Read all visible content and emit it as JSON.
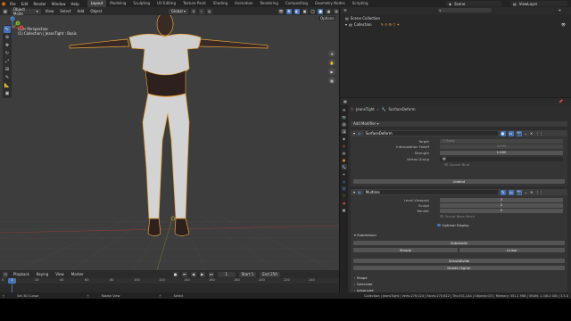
{
  "menu": [
    "File",
    "Edit",
    "Render",
    "Window",
    "Help"
  ],
  "workspaces": [
    "Layout",
    "Modeling",
    "Sculpting",
    "UV Editing",
    "Texture Paint",
    "Shading",
    "Animation",
    "Rendering",
    "Compositing",
    "Geometry Nodes",
    "Scripting"
  ],
  "active_workspace": "Layout",
  "scene": "Scene",
  "view_layer": "ViewLayer",
  "viewport_header": {
    "mode": "Object Mode",
    "menus": [
      "View",
      "Select",
      "Add",
      "Object"
    ],
    "orientation": "Global",
    "options": "Options"
  },
  "viewport": {
    "view_name": "User Perspective",
    "collection_info": "(1) Collection | JeansTight : Basis",
    "gizmo": {
      "x": "X",
      "y": "Y",
      "z": "Z"
    }
  },
  "timeline": {
    "menus": [
      "Playback",
      "Keying",
      "View",
      "Marker"
    ],
    "current_frame": "1",
    "start_label": "Start",
    "start": "1",
    "end_label": "End",
    "end": "250",
    "ticks": [
      "0",
      "20",
      "40",
      "60",
      "80",
      "100",
      "120",
      "140",
      "160",
      "180",
      "200",
      "220",
      "240"
    ]
  },
  "statusbar": {
    "left": "Set 3D Cursor",
    "middle": "Rotate View",
    "right": "Select",
    "stats": "Collection | JeansTight | Verts:276,024 | Faces:275,622 | Tris:551,244 | Objects:0/3 | Memory: 351.1 MiB | VRAM: 1.3/8.0 GiB | 3.5.0"
  },
  "outliner": {
    "rows": [
      "Scene Collection",
      "Collection"
    ]
  },
  "properties": {
    "breadcrumb_object": "JeansTight",
    "breadcrumb_modifier": "SurfaceDeform",
    "add_modifier": "Add Modifier",
    "surface_deform": {
      "name": "SurfaceDeform",
      "target_label": "Target",
      "target_value": "Body",
      "interp_label": "Interpolation Falloff",
      "interp_value": "4.000",
      "strength_label": "Strength",
      "strength_value": "1.000",
      "vgroup_label": "Vertex Group",
      "sparse_label": "Sparse Bind",
      "unbind": "Unbind"
    },
    "multires": {
      "name": "Multires",
      "level_vp_label": "Level Viewport",
      "level_vp_value": "2",
      "sculpt_label": "Sculpt",
      "sculpt_value": "2",
      "render_label": "Render",
      "render_value": "2",
      "sculpt_base_label": "Sculpt Base Mesh",
      "optimal_label": "Optimal Display",
      "subdivision_label": "Subdivision",
      "subdivide": "Subdivide",
      "simple": "Simple",
      "linear": "Linear",
      "unsubdivide": "Unsubdivide",
      "delete_higher": "Delete Higher",
      "shape": "Shape",
      "generate": "Generate",
      "advanced": "Advanced"
    }
  },
  "colors": {
    "accent_blue": "#4772b3",
    "selection_orange": "#e8a33a",
    "blender_orange": "#e87d0d"
  }
}
